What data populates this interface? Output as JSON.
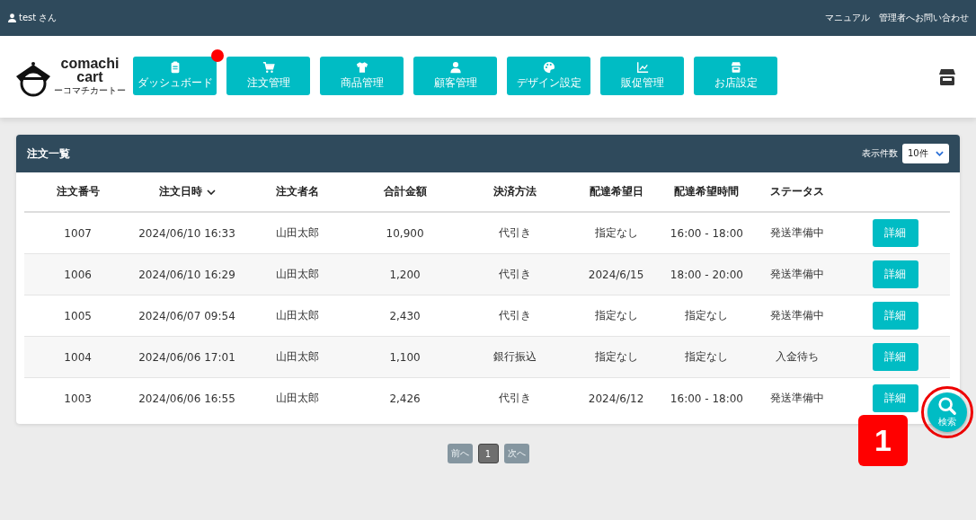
{
  "top_bar": {
    "user": "test さん",
    "links": [
      "マニュアル",
      "管理者へお問い合わせ"
    ]
  },
  "logo": {
    "title": "comachi\ncart",
    "subtitle": "ーコマチカートー"
  },
  "nav": [
    {
      "label": "ダッシュボード",
      "notification": true
    },
    {
      "label": "注文管理",
      "notification": false
    },
    {
      "label": "商品管理",
      "notification": false
    },
    {
      "label": "顧客管理",
      "notification": false
    },
    {
      "label": "デザイン設定",
      "notification": false
    },
    {
      "label": "販促管理",
      "notification": false
    },
    {
      "label": "お店設定",
      "notification": false
    }
  ],
  "panel": {
    "title": "注文一覧",
    "page_size_label": "表示件数",
    "page_size": "10件"
  },
  "table": {
    "columns": [
      {
        "label": "注文番号",
        "sorted": false
      },
      {
        "label": "注文日時",
        "sorted": true
      },
      {
        "label": "注文者名",
        "sorted": false
      },
      {
        "label": "合計金額",
        "sorted": false
      },
      {
        "label": "決済方法",
        "sorted": false
      },
      {
        "label": "配達希望日",
        "sorted": false
      },
      {
        "label": "配達希望時間",
        "sorted": false
      },
      {
        "label": "ステータス",
        "sorted": false
      }
    ],
    "rows": [
      {
        "cells": [
          "1007",
          "2024/06/10 16:33",
          "山田太郎",
          "10,900",
          "代引き",
          "指定なし",
          "16:00 - 18:00",
          "発送準備中"
        ],
        "action": "詳細"
      },
      {
        "cells": [
          "1006",
          "2024/06/10 16:29",
          "山田太郎",
          "1,200",
          "代引き",
          "2024/6/15",
          "18:00 - 20:00",
          "発送準備中"
        ],
        "action": "詳細"
      },
      {
        "cells": [
          "1005",
          "2024/06/07 09:54",
          "山田太郎",
          "2,430",
          "代引き",
          "指定なし",
          "指定なし",
          "発送準備中"
        ],
        "action": "詳細"
      },
      {
        "cells": [
          "1004",
          "2024/06/06 17:01",
          "山田太郎",
          "1,100",
          "銀行振込",
          "指定なし",
          "指定なし",
          "入金待ち"
        ],
        "action": "詳細"
      },
      {
        "cells": [
          "1003",
          "2024/06/06 16:55",
          "山田太郎",
          "2,426",
          "代引き",
          "2024/6/12",
          "16:00 - 18:00",
          "発送準備中"
        ],
        "action": "詳細"
      }
    ]
  },
  "pagination": [
    {
      "label": "前へ",
      "selected": false,
      "disabled": true
    },
    {
      "label": "1",
      "selected": true,
      "disabled": false
    },
    {
      "label": "次へ",
      "selected": false,
      "disabled": true
    }
  ],
  "annotation": {
    "number": "1"
  },
  "search_button": {
    "label": "検索"
  }
}
